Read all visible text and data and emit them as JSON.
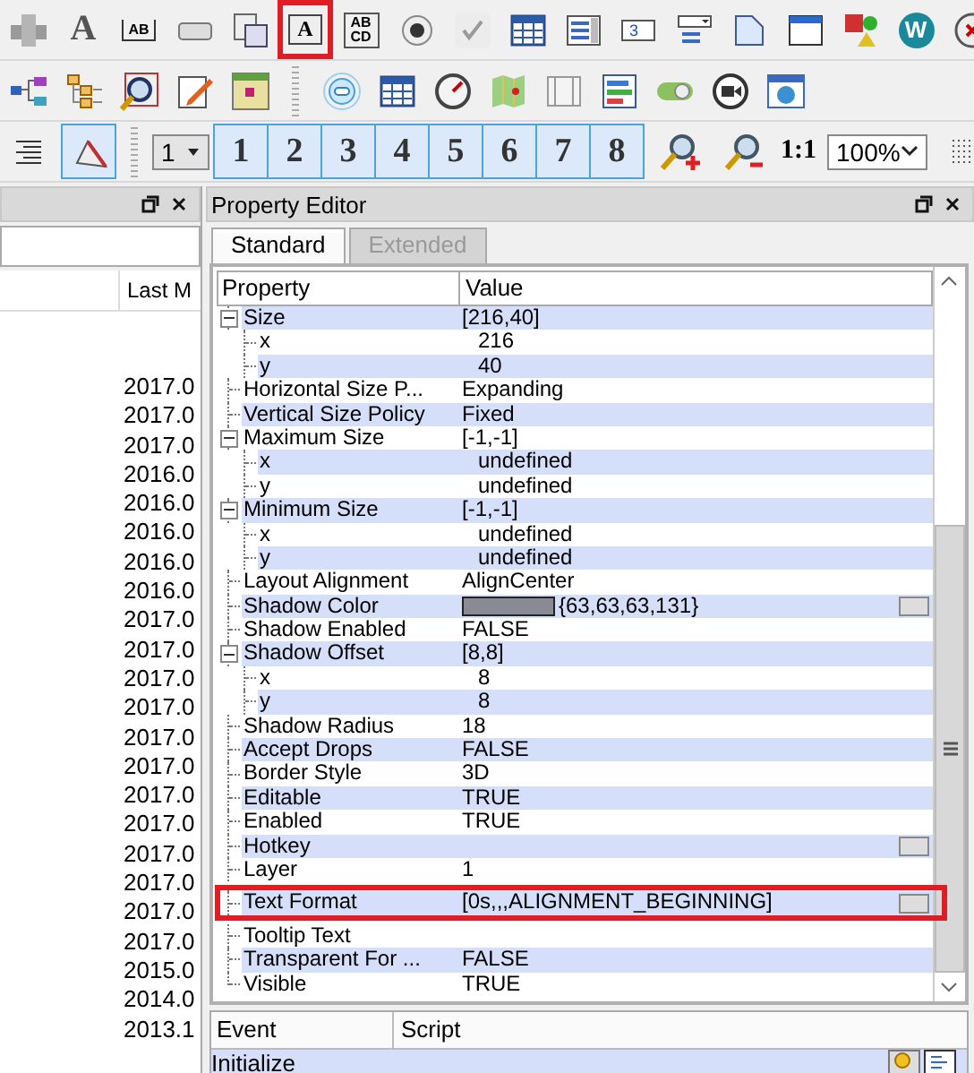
{
  "toolbar_rows": [
    [
      {
        "kind": "pipe"
      },
      {
        "kind": "letter",
        "glyph": "A"
      },
      {
        "kind": "label",
        "glyph": "AB"
      },
      {
        "kind": "button"
      },
      {
        "kind": "form"
      },
      {
        "kind": "boxed-letter",
        "glyph": "A",
        "highlighted": true
      },
      {
        "kind": "textbox",
        "glyph": "AB CD"
      },
      {
        "kind": "radio"
      },
      {
        "kind": "check"
      },
      {
        "kind": "grid"
      },
      {
        "kind": "list"
      },
      {
        "kind": "spin",
        "glyph": "3"
      },
      {
        "kind": "combo"
      },
      {
        "kind": "page"
      },
      {
        "kind": "window"
      },
      {
        "kind": "shapes"
      },
      {
        "kind": "web",
        "glyph": "W"
      },
      {
        "kind": "close"
      }
    ],
    [
      {
        "kind": "tree"
      },
      {
        "kind": "tree2"
      },
      {
        "kind": "zoom"
      },
      {
        "kind": "edit"
      },
      {
        "kind": "calendar"
      },
      {
        "kind": "sep"
      },
      {
        "kind": "target"
      },
      {
        "kind": "grid2"
      },
      {
        "kind": "gauge"
      },
      {
        "kind": "map"
      },
      {
        "kind": "panels"
      },
      {
        "kind": "bars"
      },
      {
        "kind": "toggle"
      },
      {
        "kind": "camera"
      },
      {
        "kind": "globe"
      }
    ]
  ],
  "layout_bar": {
    "align_selected": false,
    "shape_selected": true,
    "layer_combo": "1",
    "layers": [
      "1",
      "2",
      "3",
      "4",
      "5",
      "6",
      "7",
      "8"
    ],
    "actual_size": "1:1",
    "zoom_combo": "100%"
  },
  "left_panel": {
    "column_header": "Last M",
    "rows": [
      "2017.0",
      "2017.0",
      "2017.0",
      "2016.0",
      "2016.0",
      "2016.0",
      "2016.0",
      "2016.0",
      "2017.0",
      "2017.0",
      "2017.0",
      "2017.0",
      "2017.0",
      "2017.0",
      "2017.0",
      "2017.0",
      "2017.0",
      "2017.0",
      "2017.0",
      "2017.0",
      "2015.0",
      "2014.0",
      "2013.1"
    ]
  },
  "property_editor": {
    "title": "Property Editor",
    "tabs": [
      {
        "label": "Standard",
        "selected": true,
        "disabled": false
      },
      {
        "label": "Extended",
        "selected": false,
        "disabled": true
      }
    ],
    "columns": [
      "Property",
      "Value"
    ],
    "properties": [
      {
        "name": "Size",
        "value": "[216,40]",
        "expanded": true,
        "children": [
          {
            "name": "x",
            "value": "216"
          },
          {
            "name": "y",
            "value": "40"
          }
        ]
      },
      {
        "name": "Horizontal Size P...",
        "value": "Expanding"
      },
      {
        "name": "Vertical Size Policy",
        "value": "Fixed"
      },
      {
        "name": "Maximum Size",
        "value": "[-1,-1]",
        "expanded": true,
        "children": [
          {
            "name": "x",
            "value": "undefined"
          },
          {
            "name": "y",
            "value": "undefined"
          }
        ]
      },
      {
        "name": "Minimum Size",
        "value": "[-1,-1]",
        "expanded": true,
        "children": [
          {
            "name": "x",
            "value": "undefined"
          },
          {
            "name": "y",
            "value": "undefined"
          }
        ]
      },
      {
        "name": "Layout Alignment",
        "value": "AlignCenter"
      },
      {
        "name": "Shadow Color",
        "value": "{63,63,63,131}",
        "color": "#8a8a96",
        "editor_button": true
      },
      {
        "name": "Shadow Enabled",
        "value": "FALSE"
      },
      {
        "name": "Shadow Offset",
        "value": "[8,8]",
        "expanded": true,
        "children": [
          {
            "name": "x",
            "value": "8"
          },
          {
            "name": "y",
            "value": "8"
          }
        ]
      },
      {
        "name": "Shadow Radius",
        "value": "18"
      },
      {
        "name": "Accept Drops",
        "value": "FALSE"
      },
      {
        "name": "Border Style",
        "value": "3D"
      },
      {
        "name": "Editable",
        "value": "TRUE"
      },
      {
        "name": "Enabled",
        "value": "TRUE"
      },
      {
        "name": "Hotkey",
        "editor_button": true
      },
      {
        "name": "Layer",
        "value": "1"
      },
      {
        "name": "Text Format",
        "value": "[0s,,,ALIGNMENT_BEGINNING]",
        "editor_button": true,
        "highlighted": true
      },
      {
        "name": "Tooltip Text"
      },
      {
        "name": "Transparent For ...",
        "value": "FALSE"
      },
      {
        "name": "Visible",
        "value": "TRUE"
      }
    ],
    "event_columns": [
      "Event",
      "Script"
    ],
    "events": [
      "Initialize"
    ]
  }
}
